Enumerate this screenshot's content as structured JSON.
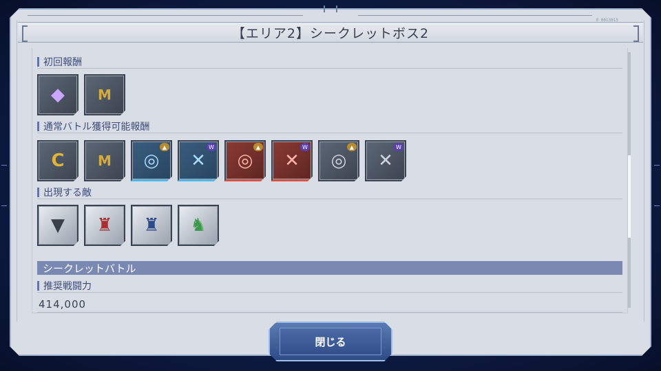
{
  "title": "【エリア2】シークレットボス2",
  "corner_text": "0 0013015",
  "sections": {
    "first_reward": "初回報酬",
    "normal_reward": "通常バトル獲得可能報酬",
    "enemies": "出現する敵",
    "secret_battle": "シークレットバトル",
    "recommended_power": "推奨戦闘力"
  },
  "first_rewards": [
    {
      "icon": "gem-icon",
      "glyph": "◆",
      "color": "#c9a7ff"
    },
    {
      "icon": "medal-icon",
      "glyph": "M",
      "color": "#d6a93c"
    }
  ],
  "normal_rewards": [
    {
      "icon": "coin-icon",
      "glyph": "C",
      "color": "#e0b53a"
    },
    {
      "icon": "medal-icon",
      "glyph": "M",
      "color": "#d6a93c"
    },
    {
      "icon": "blue-swirl-icon",
      "badge": "gold",
      "tint": "blue"
    },
    {
      "icon": "blue-swirl-icon",
      "badge": "purple",
      "tint": "blue"
    },
    {
      "icon": "red-swirl-icon",
      "badge": "gold",
      "tint": "red"
    },
    {
      "icon": "red-swirl-icon",
      "badge": "purple",
      "tint": "red"
    },
    {
      "icon": "gray-swirl-icon",
      "badge": "gold",
      "tint": "gray"
    },
    {
      "icon": "gray-swirl-icon",
      "badge": "purple",
      "tint": "gray"
    }
  ],
  "enemies": [
    {
      "icon": "enemy-mech-1-icon"
    },
    {
      "icon": "enemy-mech-2-icon"
    },
    {
      "icon": "enemy-mech-3-icon"
    },
    {
      "icon": "enemy-mech-4-icon"
    }
  ],
  "power_value": "414,000",
  "close_label": "閉じる"
}
